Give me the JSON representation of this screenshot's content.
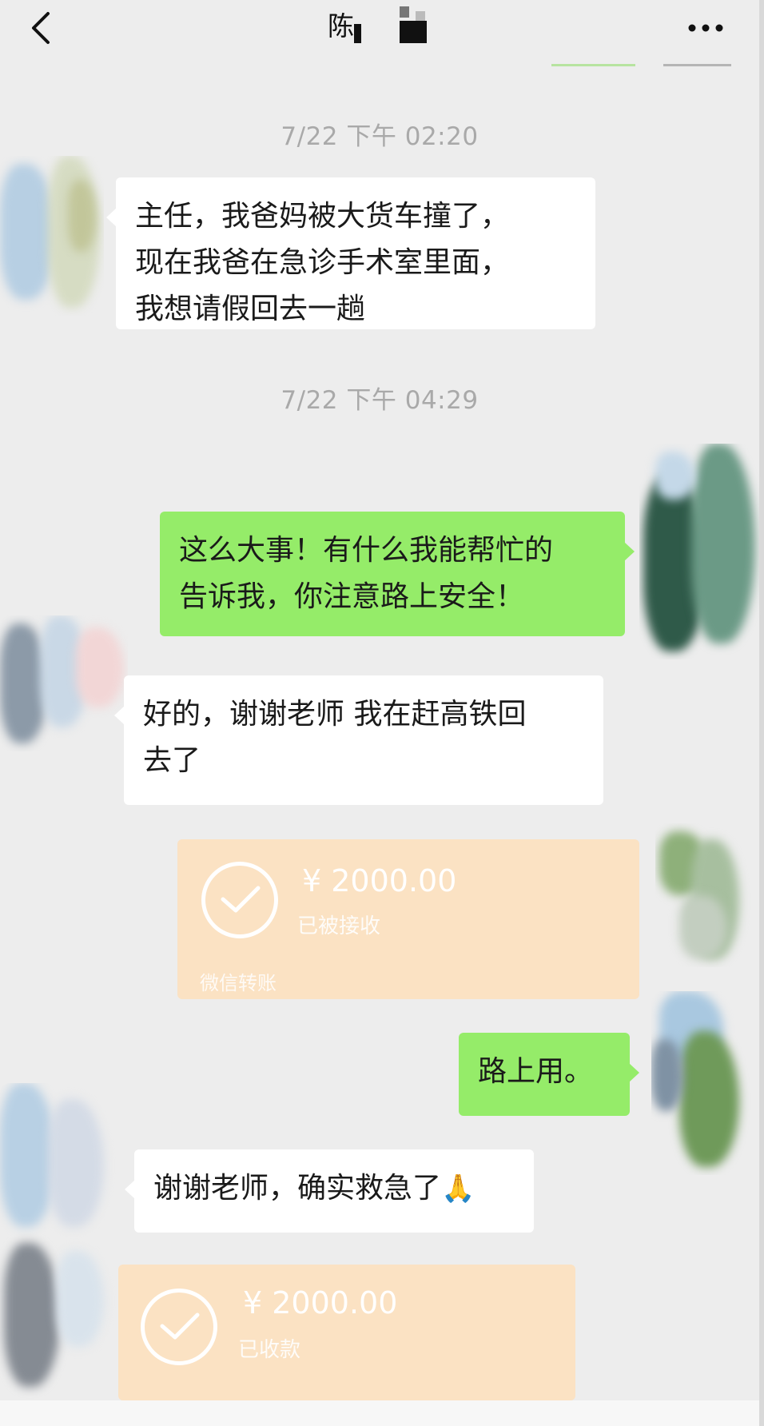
{
  "header": {
    "title": "陈",
    "back_icon": "chevron-left-icon",
    "more_icon": "ellipsis-icon"
  },
  "messages": {
    "time1": "7/22 下午 02:20",
    "msg1_lines": [
      "主任，我爸妈被大货车撞了，",
      "现在我爸在急诊手术室里面，",
      "我想请假回去一趟"
    ],
    "time2": "7/22 下午 04:29",
    "msg2_lines": [
      "这么大事！有什么我能帮忙的",
      "告诉我，你注意路上安全！"
    ],
    "msg3_lines": [
      "好的，谢谢老师 我在赶高铁回",
      "去了"
    ],
    "transfer1": {
      "amount": "¥ 2000.00",
      "status": "已被接收",
      "brand": "微信转账"
    },
    "msg4": "路上用。",
    "msg5": "谢谢老师，确实救急了",
    "msg5_emoji": "🙏",
    "transfer2": {
      "amount": "¥ 2000.00",
      "status": "已收款"
    }
  },
  "colors": {
    "background": "#ededed",
    "bubble_sent": "#95ec69",
    "bubble_received": "#ffffff",
    "transfer_card": "#fbe2c3",
    "timestamp": "#a9a9a9"
  }
}
